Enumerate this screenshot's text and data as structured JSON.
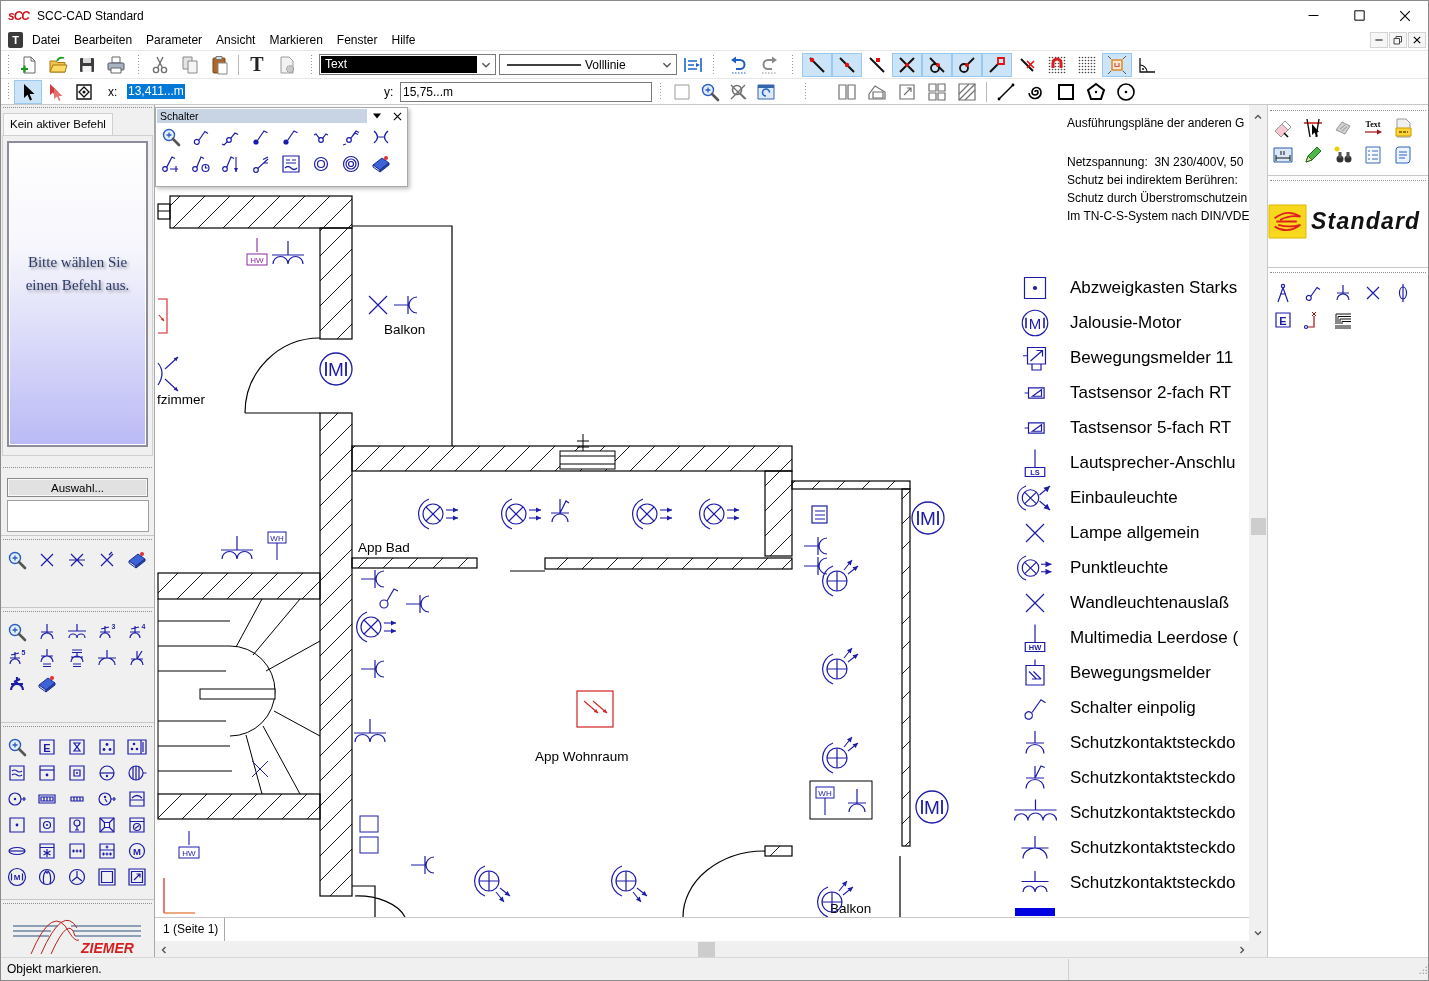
{
  "window": {
    "logo": "sCC",
    "title": "SCC-CAD Standard"
  },
  "menu": {
    "document_icon": "T",
    "items": [
      {
        "label": "Datei"
      },
      {
        "label": "Bearbeiten"
      },
      {
        "label": "Parameter"
      },
      {
        "label": "Ansicht"
      },
      {
        "label": "Markieren"
      },
      {
        "label": "Fenster"
      },
      {
        "label": "Hilfe"
      }
    ]
  },
  "toolbar": {
    "text_tool": "T",
    "layer": "Text",
    "line_type": "Volllinie",
    "snap_buttons": [
      {
        "kind": "line_end",
        "selected": true
      },
      {
        "kind": "line_mid",
        "selected": true
      },
      {
        "kind": "line_near",
        "selected": false
      },
      {
        "kind": "cross_dot",
        "selected": true
      },
      {
        "kind": "circle_tangent",
        "selected": true
      },
      {
        "kind": "circle_line",
        "selected": true
      },
      {
        "kind": "line_square",
        "selected": true
      },
      {
        "kind": "crossed_line",
        "selected": false
      },
      {
        "kind": "magnet",
        "selected": false
      },
      {
        "kind": "dot_grid",
        "selected": false
      },
      {
        "kind": "frame",
        "selected": true
      },
      {
        "kind": "angle",
        "selected": false
      }
    ]
  },
  "coords": {
    "select_tools": [
      {
        "kind": "pointer",
        "selected": true
      },
      {
        "kind": "multi_pointer",
        "selected": false
      },
      {
        "kind": "node",
        "selected": false
      }
    ],
    "x_label": "x:",
    "x_value": "13,411...m",
    "x_selected": true,
    "y_label": "y:",
    "y_value": "15,75...m"
  },
  "left_panel": {
    "tab": "Kein aktiver Befehl",
    "prompt": "Bitte wählen Sie einen Befehl aus.",
    "select_button": "Auswahl...",
    "palettes": [
      [
        {
          "kind": "zoom"
        },
        {
          "kind": "cross"
        },
        {
          "kind": "cross_arrow"
        },
        {
          "kind": "cross_tick"
        },
        {
          "kind": "book"
        }
      ],
      [
        {
          "kind": "zoom"
        },
        {
          "kind": "socket"
        },
        {
          "kind": "socket_double"
        },
        {
          "kind": "socket_numbered",
          "label": "3"
        },
        {
          "kind": "socket_numbered",
          "label": "4"
        },
        {
          "kind": "socket_numbered",
          "label": "5"
        },
        {
          "kind": "socket_boxed"
        },
        {
          "kind": "socket_cee"
        },
        {
          "kind": "socket_wide"
        },
        {
          "kind": "socket_tilted"
        },
        {
          "kind": "socket_bold"
        },
        {
          "kind": "book"
        }
      ],
      [
        {
          "kind": "zoom"
        },
        {
          "kind": "letter_box",
          "label": "E"
        },
        {
          "kind": "box_hourglass"
        },
        {
          "kind": "box_dots"
        },
        {
          "kind": "box_dots_bar"
        },
        {
          "kind": "box_wave"
        },
        {
          "kind": "box_top_dot"
        },
        {
          "kind": "box_square"
        },
        {
          "kind": "circle_half"
        },
        {
          "kind": "circle_bars"
        },
        {
          "kind": "circle_dot_tail"
        },
        {
          "kind": "bar_rect"
        },
        {
          "kind": "bar_small"
        },
        {
          "kind": "circle_dot_arrow"
        },
        {
          "kind": "box_arc"
        },
        {
          "kind": "box_dot"
        },
        {
          "kind": "box_circle"
        },
        {
          "kind": "box_bulb"
        },
        {
          "kind": "box_cross"
        },
        {
          "kind": "box_washer"
        },
        {
          "kind": "lens"
        },
        {
          "kind": "box_star"
        },
        {
          "kind": "box_pluses"
        },
        {
          "kind": "box_plus_top"
        },
        {
          "kind": "circle_letter",
          "label": "M"
        },
        {
          "kind": "circle_arrows",
          "label": "M"
        },
        {
          "kind": "circle_legs"
        },
        {
          "kind": "circle_fan"
        },
        {
          "kind": "box_inner"
        },
        {
          "kind": "box_arrow"
        }
      ]
    ],
    "logo": "ZIEMER"
  },
  "palette": {
    "title": "Schalter",
    "items": [
      {
        "kind": "zoom"
      },
      {
        "kind": "switch"
      },
      {
        "kind": "switch_two"
      },
      {
        "kind": "switch_dim"
      },
      {
        "kind": "switch_dim"
      },
      {
        "kind": "switch_cross"
      },
      {
        "kind": "switch_series"
      },
      {
        "kind": "switch_x"
      },
      {
        "kind": "switch_push"
      },
      {
        "kind": "switch_timer"
      },
      {
        "kind": "switch_arrow"
      },
      {
        "kind": "switch_pull"
      },
      {
        "kind": "box_wave_line"
      },
      {
        "kind": "ring"
      },
      {
        "kind": "ring_double"
      },
      {
        "kind": "book"
      }
    ]
  },
  "plan": {
    "room_labels": [
      "Balkon",
      "fzimmer",
      "App Bad",
      "App Wohnraum",
      "Balkon"
    ],
    "motors": [
      "M",
      "M",
      "M"
    ],
    "socket_tags": [
      "HW",
      "WH",
      "HW",
      "WH"
    ]
  },
  "legend": {
    "notes": [
      "Ausführungspläne der anderen G",
      "Netzspannung:  3N 230/400V, 50",
      "Schutz bei indirektem Berühren:",
      "Schutz durch Überstromschutzein",
      "Im TN-C-S-System nach DIN/VDE"
    ],
    "items": [
      {
        "kind": "box_dot",
        "label": "Abzweigkasten Starks"
      },
      {
        "kind": "motor",
        "tag": "M",
        "label": "Jalousie-Motor"
      },
      {
        "kind": "sensor_box",
        "label": "Bewegungsmelder 11"
      },
      {
        "kind": "touch_sensor",
        "label": "Tastsensor 2-fach RT"
      },
      {
        "kind": "touch_sensor",
        "label": "Tastsensor 5-fach RT"
      },
      {
        "kind": "tagged_socket",
        "tag": "LS",
        "label": "Lautsprecher-Anschlu"
      },
      {
        "kind": "lamp_arrows",
        "label": "Einbauleuchte"
      },
      {
        "kind": "cross",
        "label": "Lampe allgemein"
      },
      {
        "kind": "spot_lamp",
        "label": "Punktleuchte"
      },
      {
        "kind": "cross",
        "label": "Wandleuchtenauslaß"
      },
      {
        "kind": "tagged_socket",
        "tag": "HW",
        "label": "Multimedia Leerdose ("
      },
      {
        "kind": "motion_box",
        "label": "Bewegungsmelder"
      },
      {
        "kind": "switch",
        "label": "Schalter einpolig"
      },
      {
        "kind": "socket",
        "label": "Schutzkontaktsteckdo"
      },
      {
        "kind": "socket_switch",
        "label": "Schutzkontaktsteckdo"
      },
      {
        "kind": "socket_triple",
        "label": "Schutzkontaktsteckdo"
      },
      {
        "kind": "socket_wide",
        "label": "Schutzkontaktsteckdo"
      },
      {
        "kind": "socket_double",
        "label": "Schutzkontaktsteckdo"
      },
      {
        "kind": "filled_bar"
      }
    ]
  },
  "page_tab": "1 (Seite 1)",
  "right_panel": {
    "tools": [
      {
        "kind": "eraser"
      },
      {
        "kind": "lines_cursor"
      },
      {
        "kind": "tilted_tile"
      },
      {
        "kind": "text_arrow",
        "label": "Text"
      },
      {
        "kind": "file"
      },
      {
        "kind": "dimension"
      },
      {
        "kind": "pencil"
      },
      {
        "kind": "binoculars"
      },
      {
        "kind": "list"
      },
      {
        "kind": "document"
      }
    ],
    "brand": "Standard",
    "symbols": [
      {
        "kind": "compass"
      },
      {
        "kind": "switch"
      },
      {
        "kind": "socket"
      },
      {
        "kind": "cross"
      },
      {
        "kind": "fuse"
      },
      {
        "kind": "letter_box",
        "label": "E"
      },
      {
        "kind": "corner"
      },
      {
        "kind": "stairs"
      }
    ]
  },
  "status_bar": {
    "message": "Objekt markieren."
  }
}
